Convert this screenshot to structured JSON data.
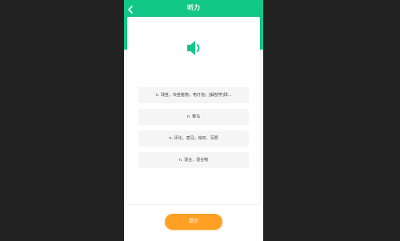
{
  "header": {
    "title": "听力",
    "back_icon": "chevron-left-icon"
  },
  "card": {
    "speaker_icon": "speaker-icon",
    "options": [
      "n. 球茎，块茎植物；电灯泡；[解剖学]球...",
      "n. 擎鸟",
      "n. 评论，意见；惊叹，写照",
      "n. 混合，混合物"
    ]
  },
  "footer": {
    "hint_label": "提示"
  },
  "colors": {
    "accent": "#12c889",
    "button": "#ffa024",
    "backdrop": "#222222"
  }
}
